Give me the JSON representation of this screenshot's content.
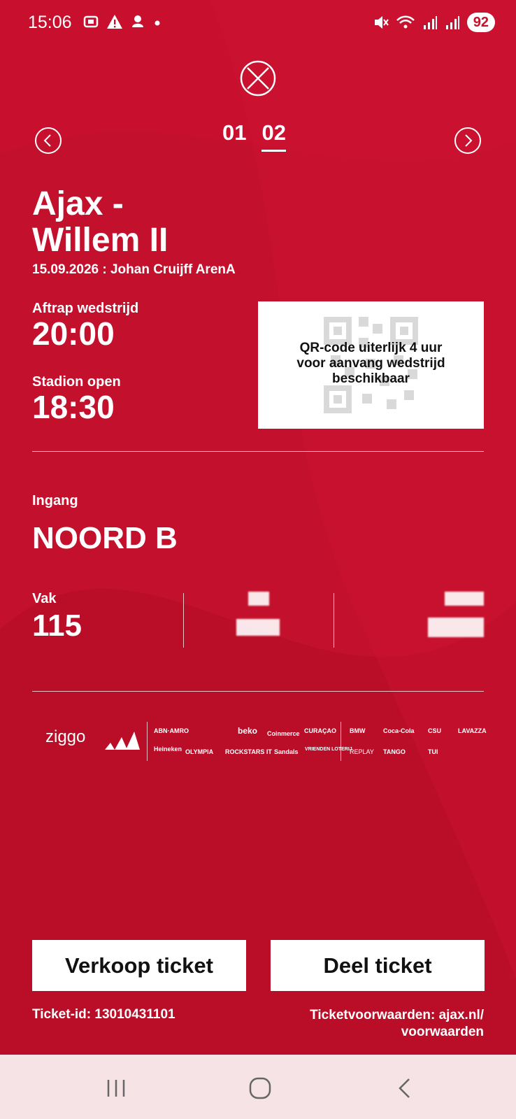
{
  "status_bar": {
    "time": "15:06",
    "battery": "92",
    "icons_left": [
      "screenshot-icon",
      "warning-icon",
      "bell-icon",
      "dot-icon"
    ],
    "icons_right": [
      "mute-icon",
      "wifi-icon",
      "signal-icon",
      "signal-icon"
    ]
  },
  "pager": {
    "tabs": [
      "01",
      "02"
    ],
    "active_index": 1
  },
  "match": {
    "title_line1": "Ajax -",
    "title_line2": "Willem II",
    "meta": "15.09.2026 : Johan Cruijff ArenA"
  },
  "kickoff": {
    "label": "Aftrap wedstrijd",
    "value": "20:00"
  },
  "stadium": {
    "label": "Stadion open",
    "value": "18:30"
  },
  "qr": {
    "message_line1": "QR-code uiterlijk 4 uur",
    "message_line2": "voor aanvang wedstrijd",
    "message_line3": "beschikbaar"
  },
  "entrance": {
    "label": "Ingang",
    "value": "NOORD B"
  },
  "seat_info": {
    "vak_label": "Vak",
    "vak_value": "115"
  },
  "sponsors": {
    "primary": [
      "ziggo"
    ],
    "row1": [
      "ABN·AMRO",
      "beko",
      "Coinmerce",
      "CURAÇAO",
      "BMW",
      "Coca-Cola",
      "CSU",
      "LAVAZZA"
    ],
    "row2": [
      "Heineken",
      "OLYMPIA",
      "ROCKSTARS IT",
      "Sandals",
      "VRIENDEN LOTERIJ",
      "REPLAY",
      "TANGO",
      "TUI"
    ]
  },
  "actions": {
    "sell_label": "Verkoop ticket",
    "share_label": "Deel ticket"
  },
  "footer": {
    "ticket_id": "Ticket-id: 13010431101",
    "terms_line1": "Ticketvoorwaarden: ajax.nl/",
    "terms_line2": "voorwaarden"
  },
  "colors": {
    "background": "#c8102e",
    "text": "#ffffff",
    "navbar": "#f5e3e6"
  }
}
